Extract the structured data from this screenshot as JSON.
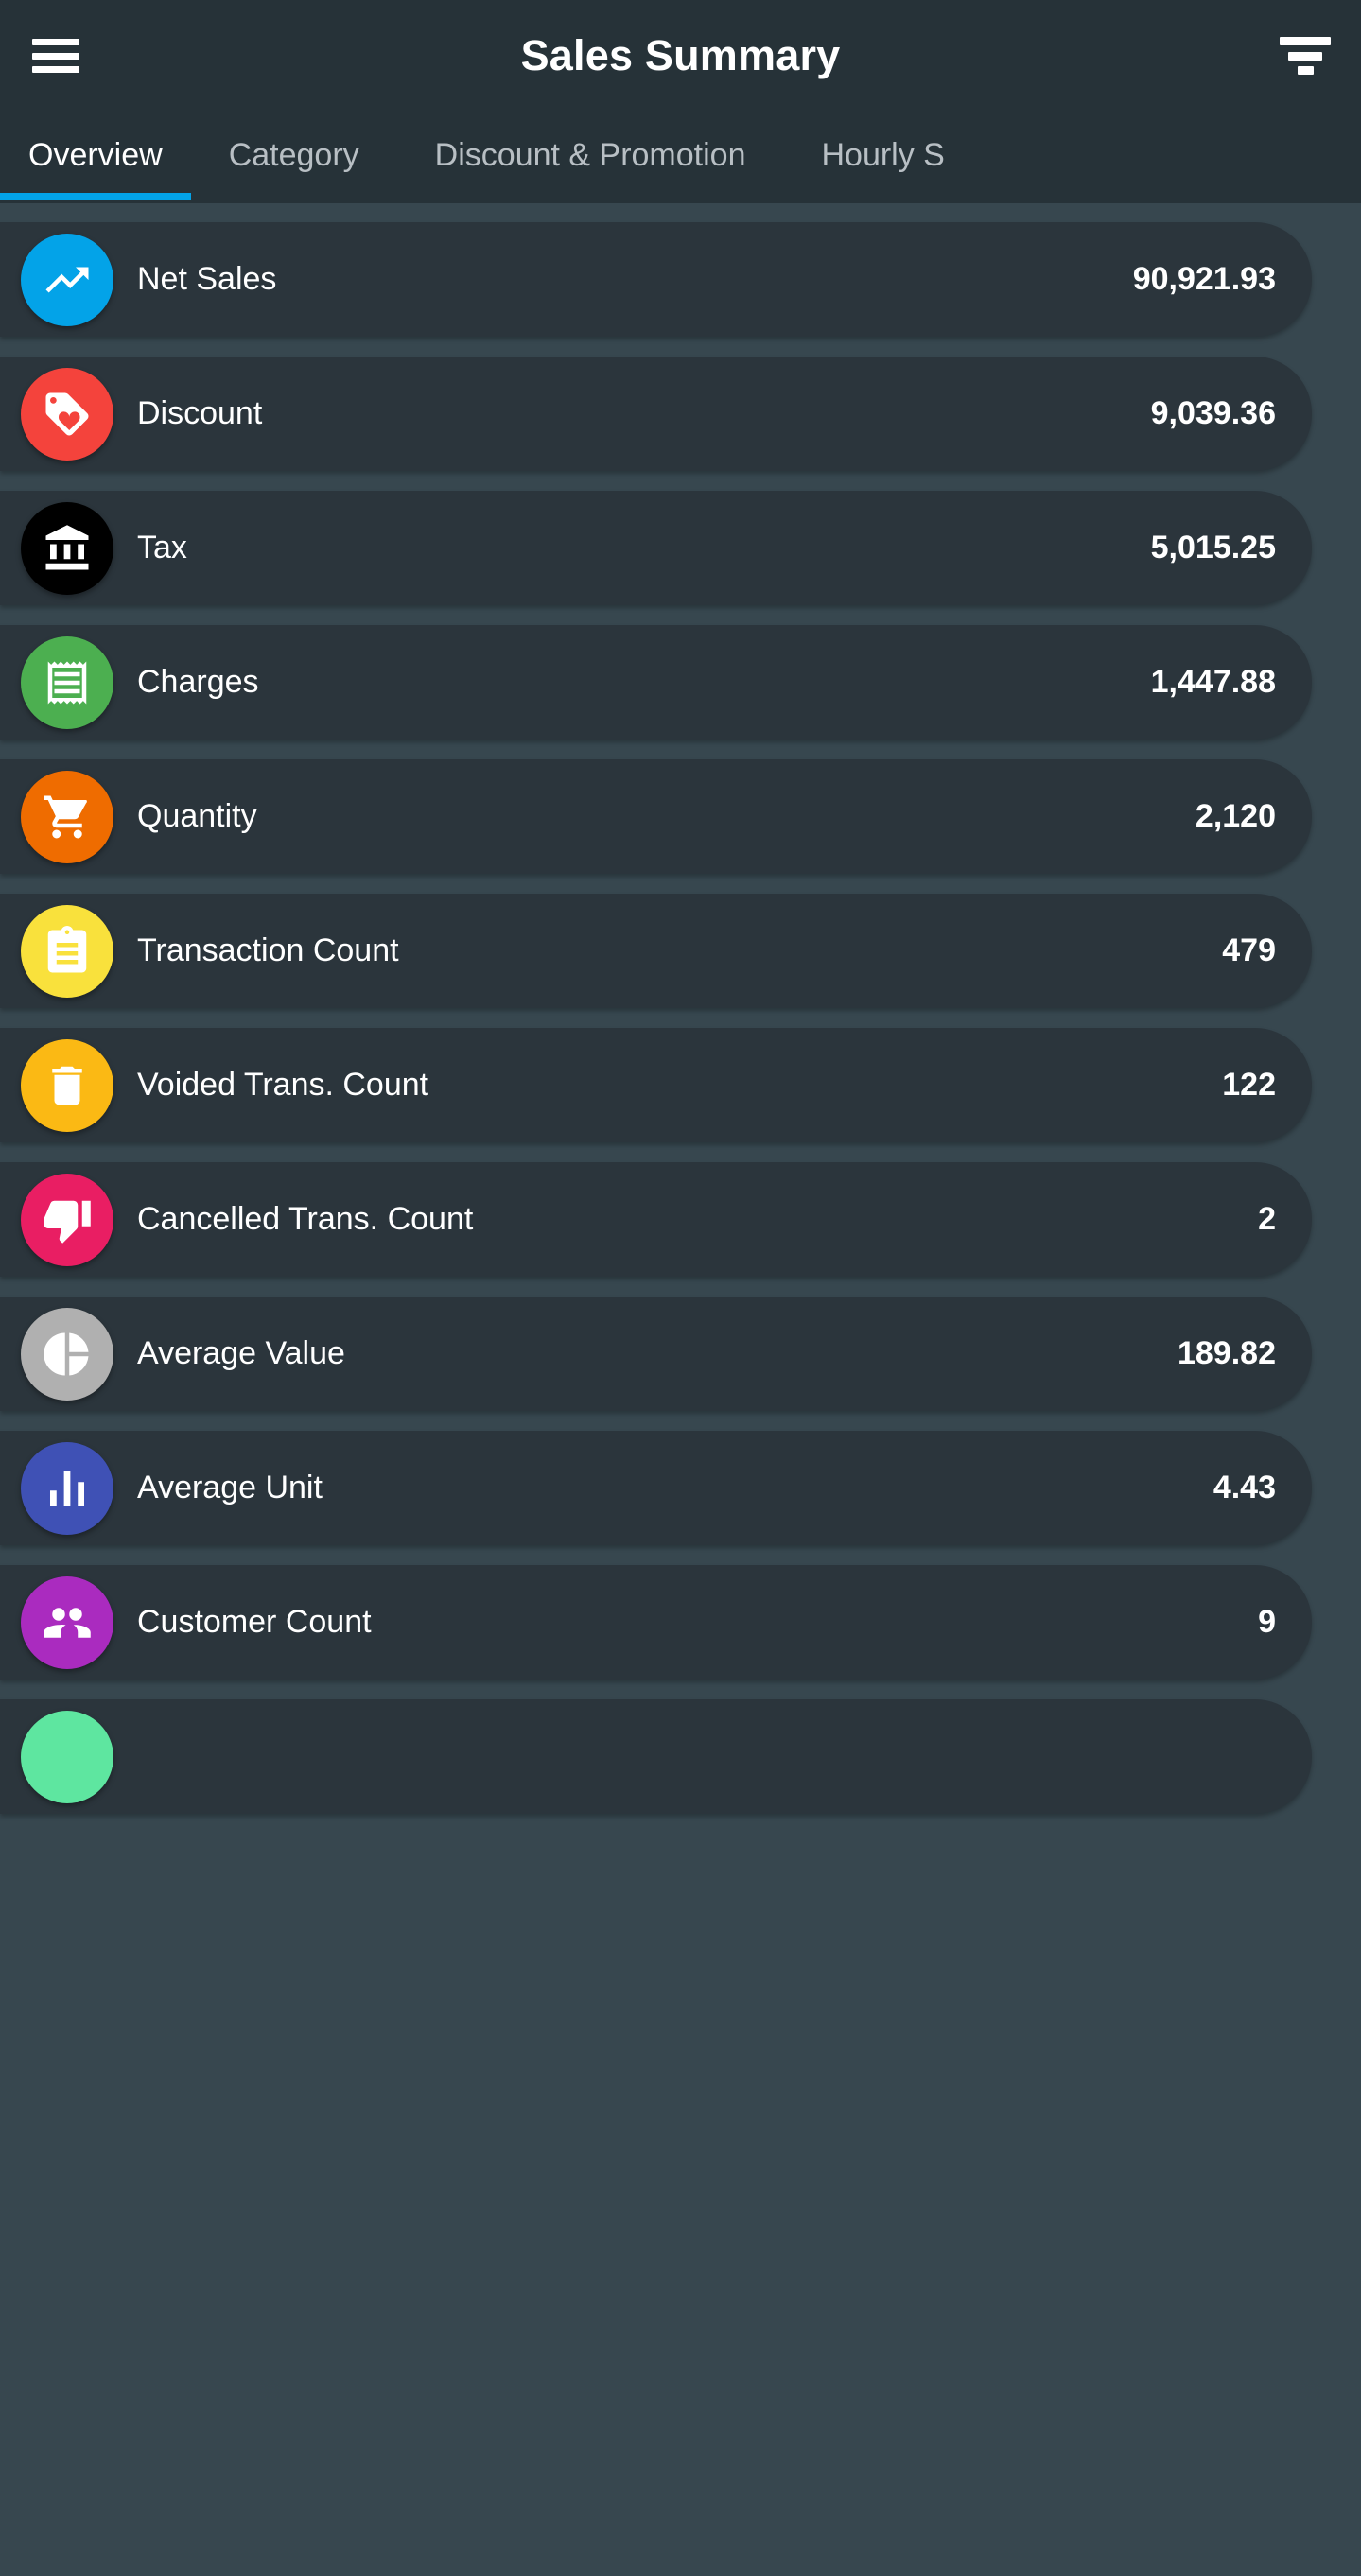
{
  "appbar": {
    "title": "Sales Summary",
    "menu_icon": "hamburger-menu-icon",
    "filter_icon": "filter-list-icon"
  },
  "tabs": {
    "active_index": 0,
    "items": [
      {
        "label": "Overview"
      },
      {
        "label": "Category"
      },
      {
        "label": "Discount & Promotion"
      },
      {
        "label": "Hourly S"
      }
    ]
  },
  "colors": {
    "background": "#37474f",
    "appbar": "#263238",
    "card": "#2b353c",
    "accent": "#03a3e8",
    "text_primary": "#ffffff",
    "text_muted": "#b8bfc4"
  },
  "summary_rows": [
    {
      "label": "Net Sales",
      "value": "90,921.93",
      "icon": "trending-up-icon",
      "color": "#03a3e8"
    },
    {
      "label": "Discount",
      "value": "9,039.36",
      "icon": "loyalty-tag-icon",
      "color": "#f4433c"
    },
    {
      "label": "Tax",
      "value": "5,015.25",
      "icon": "bank-icon",
      "color": "#000000"
    },
    {
      "label": "Charges",
      "value": "1,447.88",
      "icon": "receipt-icon",
      "color": "#4caf50"
    },
    {
      "label": "Quantity",
      "value": "2,120",
      "icon": "shopping-cart-icon",
      "color": "#ef6c00"
    },
    {
      "label": "Transaction Count",
      "value": "479",
      "icon": "clipboard-icon",
      "color": "#f9e13c"
    },
    {
      "label": "Voided Trans. Count",
      "value": "122",
      "icon": "trash-icon",
      "color": "#fbb914"
    },
    {
      "label": "Cancelled Trans. Count",
      "value": "2",
      "icon": "thumb-down-icon",
      "color": "#e91e63"
    },
    {
      "label": "Average Value",
      "value": "189.82",
      "icon": "pie-chart-icon",
      "color": "#b0b0b0"
    },
    {
      "label": "Average Unit",
      "value": "4.43",
      "icon": "bar-chart-icon",
      "color": "#3f51b5"
    },
    {
      "label": "Customer Count",
      "value": "9",
      "icon": "people-icon",
      "color": "#aa2bbf"
    },
    {
      "label": "",
      "value": "",
      "icon": "partial-row-icon",
      "color": "#5ee6a0"
    }
  ]
}
